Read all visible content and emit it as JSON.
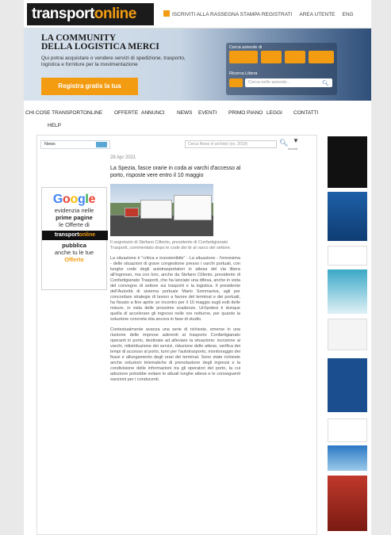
{
  "logo": {
    "part1": "transport",
    "part2": "online"
  },
  "topnav": {
    "register": "ISCRIVITI ALLA RASSEGNA STAMPA REGISTRATI",
    "user_area": "AREA UTENTE",
    "lang": "ENG"
  },
  "hero": {
    "title_line1": "LA COMMUNITY",
    "title_line2": "DELLA LOGISTICA MERCI",
    "subtitle": "Qui potrai acquistare o vendere servizi di spedizione, trasporto, logistica e forniture per la movimentazione",
    "cta": "Registra gratis la tua",
    "panel_label1": "Cerca aziende di",
    "panel_label2": "Ricerca Libera",
    "search_placeholder": "Cerca nelle aziende..."
  },
  "mainnav": {
    "items": [
      "CHI COSE TRANSPORTONLINE",
      "OFFERTE",
      "ANNUNCI",
      "NEWS",
      "EVENTI",
      "PRIMO PIANO",
      "LEGGI",
      "CONTATTI"
    ],
    "help": "HELP"
  },
  "content": {
    "tab": "News",
    "search_placeholder": "Cerca News in archivio (es. 2019)",
    "search_side_label": "Accedi"
  },
  "ad_google": {
    "google": [
      "G",
      "o",
      "o",
      "g",
      "l",
      "e"
    ],
    "line1": "evidenzia nelle",
    "line2": "prime pagine",
    "line3": "le Offerte di",
    "brand1": "transport",
    "brand2": "online",
    "line4": "pubblica",
    "line5": "anche tu le tue",
    "line6": "Offerte"
  },
  "article": {
    "date": "28 Apr 2021",
    "title": "La Spezia, fasce orarie in coda ai varchi d'accesso al porto, risposte vere entro il 10 maggio",
    "caption": "Il segretario di Stefano Cillento, presidente di Confartigianato Trasporti, commentato dopo le code dei tir al varco del settore.",
    "paragraphs": [
      "La situazione è \"critica e insostenibile\" - La situazione - l'ennesima - delle situazioni di grave congestione presso i varchi portuali, con lunghe code degli autotrasportatori in attesa del via libera all'ingresso, ma con loro, anche da Stefano Cillento, presidente di Confartigianato Trasporti, che ha lanciato una difesa, anche in vista del convegno di settore sui trasporti e la logistica. Il presidente dell'Autorità di sistema portuale Mario Sommariva, agli per concordare strategie di lavoro a favore del terminal e dei portuali, ha fissato a fine aprile un incontro per il 10 maggio sugli esiti delle misure, in vista delle prossime scadenze. Un'ipotesi è dunque quella di accelerare gli ingressi nelle ore notturne, per quanto la soluzione concreta stia ancora in fase di studio.",
      "Contestualmente avanza una serie di richieste, emerse in una riunione delle imprese aderenti al trasporto Confartigianato operanti in porto, destinate ad alleviare la situazione: iscrizione ai varchi, ridistribuzione dei servizi, riduzione delle attese, verifica dei tempi di accesso al porto, turni per l'autotrasporto, monitoraggio dei flussi e allungamento degli orari dei terminal. Sono state richieste anche soluzioni telematiche di prenotazione degli ingressi e la condivisione delle informazioni tra gli operatori del porto, la cui adozione potrebbe evitare le attuali lunghe attese e le conseguenti sanzioni per i conducenti."
    ]
  }
}
